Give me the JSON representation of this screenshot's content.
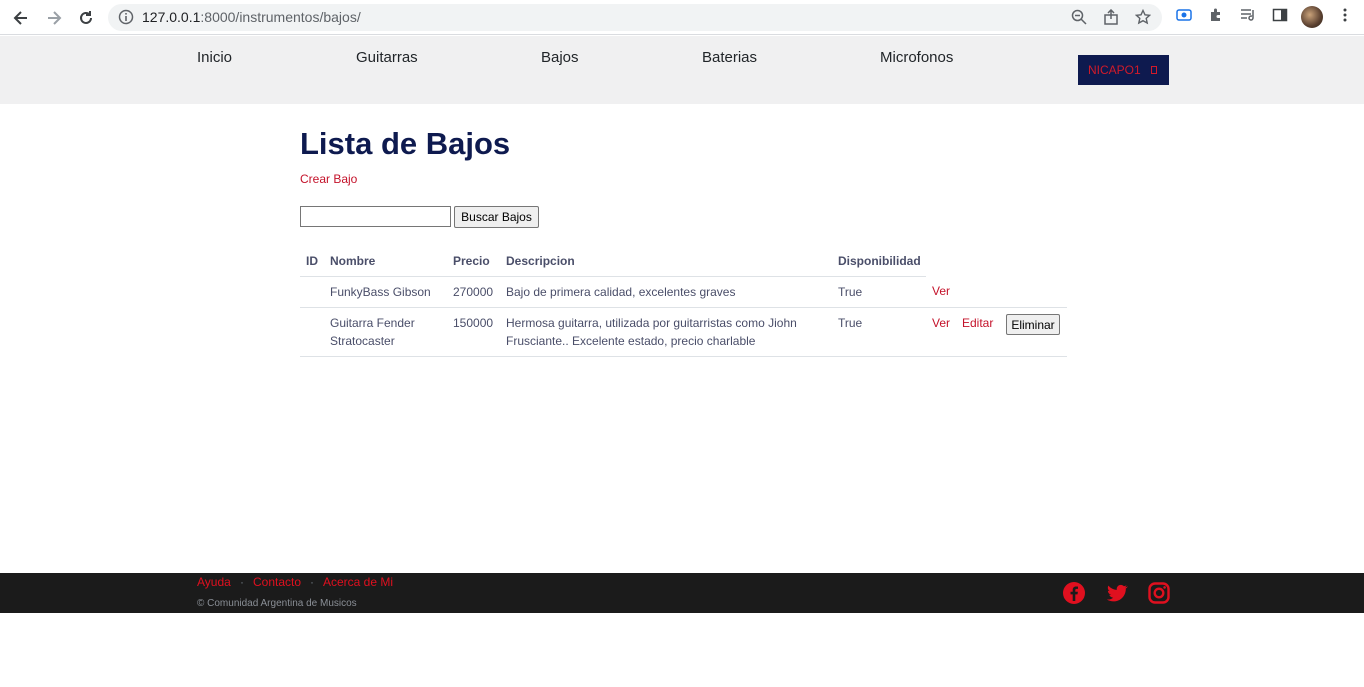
{
  "browser": {
    "url_host": "127.0.0.1",
    "url_path": ":8000/instrumentos/bajos/"
  },
  "nav": {
    "items": [
      {
        "label": "Inicio"
      },
      {
        "label": "Guitarras"
      },
      {
        "label": "Bajos"
      },
      {
        "label": "Baterias"
      },
      {
        "label": "Microfonos"
      }
    ],
    "user_label": "NICAPO1"
  },
  "main": {
    "title": "Lista de Bajos",
    "create_link": "Crear Bajo",
    "search": {
      "value": "",
      "placeholder": "",
      "button": "Buscar Bajos"
    },
    "table": {
      "headers": [
        "ID",
        "Nombre",
        "Precio",
        "Descripcion",
        "Disponibilidad"
      ],
      "rows": [
        {
          "id": "",
          "nombre": "FunkyBass Gibson",
          "precio": "270000",
          "descripcion": "Bajo de primera calidad, excelentes graves",
          "disponibilidad": "True",
          "ver": "Ver"
        },
        {
          "id": "",
          "nombre_line1": "Guitarra Fender",
          "nombre_line2": "Stratocaster",
          "precio": "150000",
          "descripcion_line1": "Hermosa guitarra, utilizada por guitarristas como Jiohn",
          "descripcion_line2": "Frusciante.. Excelente estado, precio charlable",
          "disponibilidad": "True",
          "ver": "Ver",
          "editar": "Editar",
          "eliminar": "Eliminar"
        }
      ]
    }
  },
  "footer": {
    "links": [
      "Ayuda",
      "Contacto",
      "Acerca de Mi"
    ],
    "separator": "·",
    "copyright": "© Comunidad Argentina de Musicos"
  },
  "colors": {
    "accent": "#c4122a",
    "brand_navy": "#0e1a4f",
    "footer_bg": "#1b1b1b"
  }
}
